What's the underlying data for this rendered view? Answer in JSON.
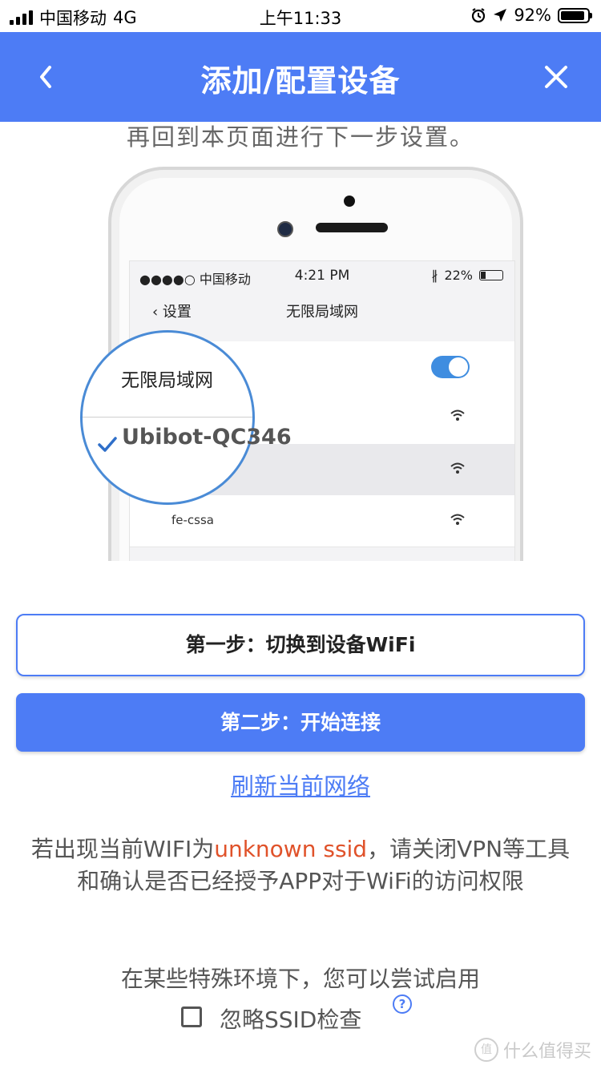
{
  "status_bar": {
    "carrier": "中国移动",
    "network": "4G",
    "time": "上午11:33",
    "battery_percent": "92%",
    "battery_level": 0.92
  },
  "nav": {
    "title": "添加/配置设备",
    "back_icon": "chevron-left-icon",
    "close_icon": "close-icon"
  },
  "intro_text": "再回到本页面进行下一步设置。",
  "illustration": {
    "phone_status": {
      "carrier": "●●●●○ 中国移动",
      "time": "4:21 PM",
      "battery": "22%"
    },
    "phone_nav": {
      "back": "设置",
      "title": "无限局域网"
    },
    "wifi_rows": [
      "fe-cssa"
    ],
    "magnifier_title": "无限局域网",
    "selected_network": "Ubibot-QC346"
  },
  "buttons": {
    "step1": "第一步：切换到设备WiFi",
    "step2": "第二步：开始连接"
  },
  "refresh_link": "刷新当前网络",
  "note": {
    "before": "若出现当前WIFI为",
    "highlight": "unknown ssid",
    "after": "，请关闭VPN等工具和确认是否已经授予APP对于WiFi的访问权限"
  },
  "special_env_text": "在某些特殊环境下，您可以尝试启用",
  "ignore_ssid_label": "忽略SSID检查",
  "help_icon_glyph": "?",
  "watermark": "什么值得买",
  "colors": {
    "primary": "#4d7cf5",
    "highlight": "#e0522a"
  }
}
